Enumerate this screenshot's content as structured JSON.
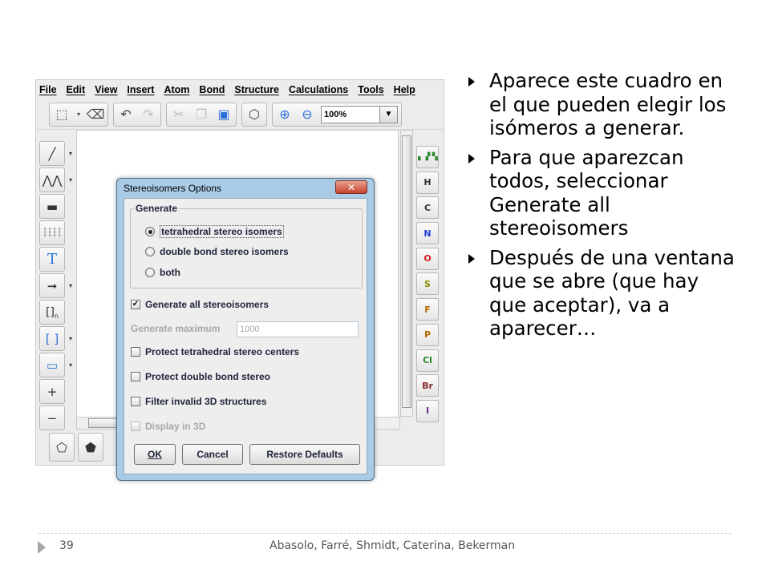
{
  "app": {
    "menus": [
      "File",
      "Edit",
      "View",
      "Insert",
      "Atom",
      "Bond",
      "Structure",
      "Calculations",
      "Tools",
      "Help"
    ],
    "zoom": "100%",
    "left_tools": [
      "single-bond-icon",
      "chain-icon",
      "wedge-bond-icon",
      "hash-bond-icon",
      "text-tool-icon",
      "reaction-arrow-icon",
      "sgroup-bracket-icon",
      "bracket-icon",
      "rectangle-icon",
      "zoom-in-plus-icon",
      "zoom-out-minus-icon"
    ],
    "elements": [
      "H",
      "C",
      "N",
      "O",
      "S",
      "F",
      "P",
      "Cl",
      "Br",
      "I"
    ],
    "element_colors": {
      "H": "#333333",
      "C": "#333333",
      "N": "#1f3fd1",
      "O": "#d11f1f",
      "S": "#8a8a00",
      "F": "#b36b00",
      "P": "#b36b00",
      "Cl": "#1f8a1f",
      "Br": "#8a2a2a",
      "I": "#6b2a8a"
    }
  },
  "dialog": {
    "title": "Stereoisomers Options",
    "group_label": "Generate",
    "radios": [
      {
        "label": "tetrahedral stereo isomers",
        "checked": true
      },
      {
        "label": "double bond stereo isomers",
        "checked": false
      },
      {
        "label": "both",
        "checked": false
      }
    ],
    "generate_all": {
      "label": "Generate all stereoisomers",
      "checked": true
    },
    "generate_max": {
      "label": "Generate maximum",
      "value": "1000"
    },
    "checkboxes": [
      {
        "label": "Protect tetrahedral stereo centers",
        "checked": false
      },
      {
        "label": "Protect double bond stereo",
        "checked": false
      },
      {
        "label": "Filter invalid 3D structures",
        "checked": false
      }
    ],
    "display_3d": {
      "label": "Display in 3D",
      "checked": false
    },
    "buttons": {
      "ok": "OK",
      "cancel": "Cancel",
      "restore": "Restore Defaults"
    }
  },
  "bullets": [
    "Aparece este cuadro en el que pueden elegir los isómeros a generar.",
    "Para que aparezcan todos, seleccionar Generate all stereoisomers",
    "Después de una ventana que se abre (que hay que aceptar), va a aparecer…"
  ],
  "footer": {
    "page": "39",
    "authors": "Abasolo, Farré, Shmidt, Caterina, Bekerman"
  }
}
